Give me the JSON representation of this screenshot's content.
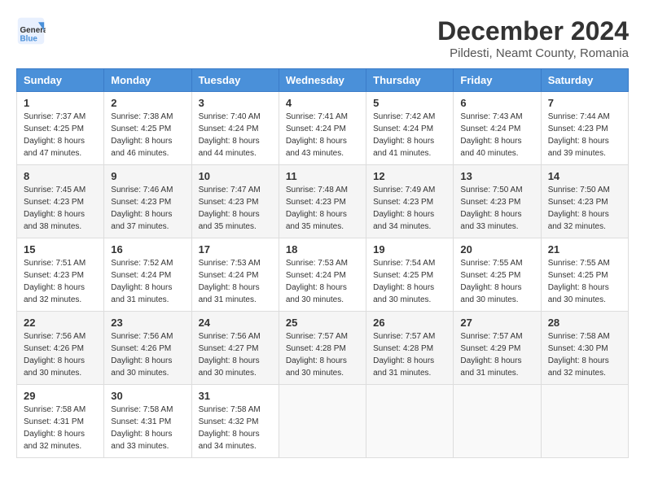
{
  "header": {
    "logo_line1": "General",
    "logo_line2": "Blue",
    "title": "December 2024",
    "subtitle": "Pildesti, Neamt County, Romania"
  },
  "calendar": {
    "days_of_week": [
      "Sunday",
      "Monday",
      "Tuesday",
      "Wednesday",
      "Thursday",
      "Friday",
      "Saturday"
    ],
    "weeks": [
      [
        null,
        null,
        null,
        null,
        null,
        null,
        null
      ]
    ]
  },
  "cells": {
    "w1": [
      null,
      null,
      null,
      null,
      null,
      null,
      null
    ]
  },
  "days": [
    {
      "date": "1",
      "sunrise": "7:37 AM",
      "sunset": "4:25 PM",
      "daylight": "8 hours and 47 minutes."
    },
    {
      "date": "2",
      "sunrise": "7:38 AM",
      "sunset": "4:25 PM",
      "daylight": "8 hours and 46 minutes."
    },
    {
      "date": "3",
      "sunrise": "7:40 AM",
      "sunset": "4:24 PM",
      "daylight": "8 hours and 44 minutes."
    },
    {
      "date": "4",
      "sunrise": "7:41 AM",
      "sunset": "4:24 PM",
      "daylight": "8 hours and 43 minutes."
    },
    {
      "date": "5",
      "sunrise": "7:42 AM",
      "sunset": "4:24 PM",
      "daylight": "8 hours and 41 minutes."
    },
    {
      "date": "6",
      "sunrise": "7:43 AM",
      "sunset": "4:24 PM",
      "daylight": "8 hours and 40 minutes."
    },
    {
      "date": "7",
      "sunrise": "7:44 AM",
      "sunset": "4:23 PM",
      "daylight": "8 hours and 39 minutes."
    },
    {
      "date": "8",
      "sunrise": "7:45 AM",
      "sunset": "4:23 PM",
      "daylight": "8 hours and 38 minutes."
    },
    {
      "date": "9",
      "sunrise": "7:46 AM",
      "sunset": "4:23 PM",
      "daylight": "8 hours and 37 minutes."
    },
    {
      "date": "10",
      "sunrise": "7:47 AM",
      "sunset": "4:23 PM",
      "daylight": "8 hours and 35 minutes."
    },
    {
      "date": "11",
      "sunrise": "7:48 AM",
      "sunset": "4:23 PM",
      "daylight": "8 hours and 35 minutes."
    },
    {
      "date": "12",
      "sunrise": "7:49 AM",
      "sunset": "4:23 PM",
      "daylight": "8 hours and 34 minutes."
    },
    {
      "date": "13",
      "sunrise": "7:50 AM",
      "sunset": "4:23 PM",
      "daylight": "8 hours and 33 minutes."
    },
    {
      "date": "14",
      "sunrise": "7:50 AM",
      "sunset": "4:23 PM",
      "daylight": "8 hours and 32 minutes."
    },
    {
      "date": "15",
      "sunrise": "7:51 AM",
      "sunset": "4:23 PM",
      "daylight": "8 hours and 32 minutes."
    },
    {
      "date": "16",
      "sunrise": "7:52 AM",
      "sunset": "4:24 PM",
      "daylight": "8 hours and 31 minutes."
    },
    {
      "date": "17",
      "sunrise": "7:53 AM",
      "sunset": "4:24 PM",
      "daylight": "8 hours and 31 minutes."
    },
    {
      "date": "18",
      "sunrise": "7:53 AM",
      "sunset": "4:24 PM",
      "daylight": "8 hours and 30 minutes."
    },
    {
      "date": "19",
      "sunrise": "7:54 AM",
      "sunset": "4:25 PM",
      "daylight": "8 hours and 30 minutes."
    },
    {
      "date": "20",
      "sunrise": "7:55 AM",
      "sunset": "4:25 PM",
      "daylight": "8 hours and 30 minutes."
    },
    {
      "date": "21",
      "sunrise": "7:55 AM",
      "sunset": "4:25 PM",
      "daylight": "8 hours and 30 minutes."
    },
    {
      "date": "22",
      "sunrise": "7:56 AM",
      "sunset": "4:26 PM",
      "daylight": "8 hours and 30 minutes."
    },
    {
      "date": "23",
      "sunrise": "7:56 AM",
      "sunset": "4:26 PM",
      "daylight": "8 hours and 30 minutes."
    },
    {
      "date": "24",
      "sunrise": "7:56 AM",
      "sunset": "4:27 PM",
      "daylight": "8 hours and 30 minutes."
    },
    {
      "date": "25",
      "sunrise": "7:57 AM",
      "sunset": "4:28 PM",
      "daylight": "8 hours and 30 minutes."
    },
    {
      "date": "26",
      "sunrise": "7:57 AM",
      "sunset": "4:28 PM",
      "daylight": "8 hours and 31 minutes."
    },
    {
      "date": "27",
      "sunrise": "7:57 AM",
      "sunset": "4:29 PM",
      "daylight": "8 hours and 31 minutes."
    },
    {
      "date": "28",
      "sunrise": "7:58 AM",
      "sunset": "4:30 PM",
      "daylight": "8 hours and 32 minutes."
    },
    {
      "date": "29",
      "sunrise": "7:58 AM",
      "sunset": "4:31 PM",
      "daylight": "8 hours and 32 minutes."
    },
    {
      "date": "30",
      "sunrise": "7:58 AM",
      "sunset": "4:31 PM",
      "daylight": "8 hours and 33 minutes."
    },
    {
      "date": "31",
      "sunrise": "7:58 AM",
      "sunset": "4:32 PM",
      "daylight": "8 hours and 34 minutes."
    }
  ]
}
